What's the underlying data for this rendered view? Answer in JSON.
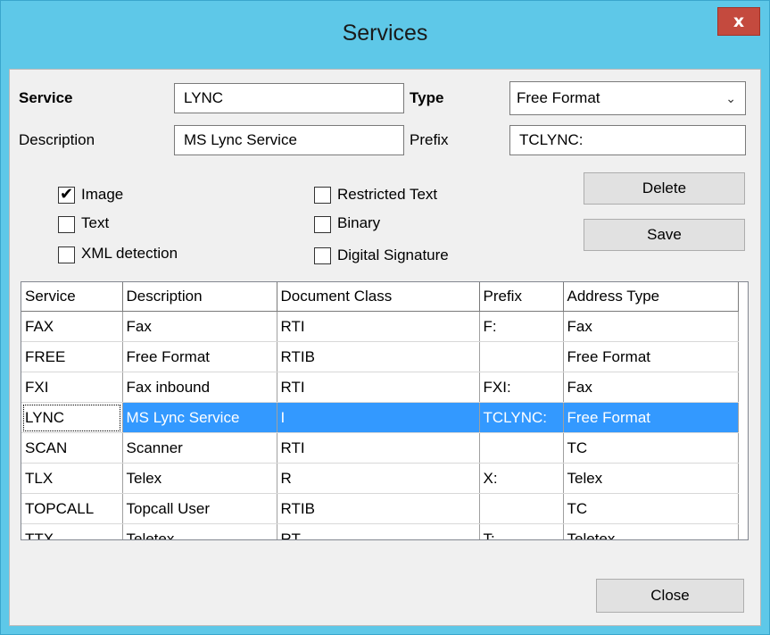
{
  "window": {
    "title": "Services",
    "close_glyph": "x"
  },
  "form": {
    "service_label": "Service",
    "service_value": "LYNC",
    "type_label": "Type",
    "type_value": "Free Format",
    "description_label": "Description",
    "description_value": "MS Lync Service",
    "prefix_label": "Prefix",
    "prefix_value": "TCLYNC:"
  },
  "checkboxes": {
    "image": {
      "label": "Image",
      "checked": true
    },
    "text": {
      "label": "Text",
      "checked": false
    },
    "xml": {
      "label": "XML detection",
      "checked": false
    },
    "restricted": {
      "label": "Restricted Text",
      "checked": false
    },
    "binary": {
      "label": "Binary",
      "checked": false
    },
    "signature": {
      "label": "Digital Signature",
      "checked": false
    }
  },
  "buttons": {
    "delete": "Delete",
    "save": "Save",
    "close": "Close"
  },
  "table": {
    "columns": [
      "Service",
      "Description",
      "Document Class",
      "Prefix",
      "Address Type"
    ],
    "rows": [
      [
        "FAX",
        "Fax",
        "RTI",
        "F:",
        "Fax"
      ],
      [
        "FREE",
        "Free Format",
        "RTIB",
        "",
        "Free Format"
      ],
      [
        "FXI",
        "Fax inbound",
        "RTI",
        "FXI:",
        "Fax"
      ],
      [
        "LYNC",
        "MS Lync Service",
        "I",
        "TCLYNC:",
        "Free Format"
      ],
      [
        "SCAN",
        "Scanner",
        "RTI",
        "",
        "TC"
      ],
      [
        "TLX",
        "Telex",
        "R",
        "X:",
        "Telex"
      ],
      [
        "TOPCALL",
        "Topcall User",
        "RTIB",
        "",
        "TC"
      ],
      [
        "TTX",
        "Teletex",
        "RT",
        "T:",
        "Teletex"
      ]
    ],
    "selected_row": 3
  },
  "colors": {
    "titlebar": "#5ec8e8",
    "close": "#c44a3e",
    "selection": "#3399ff"
  }
}
